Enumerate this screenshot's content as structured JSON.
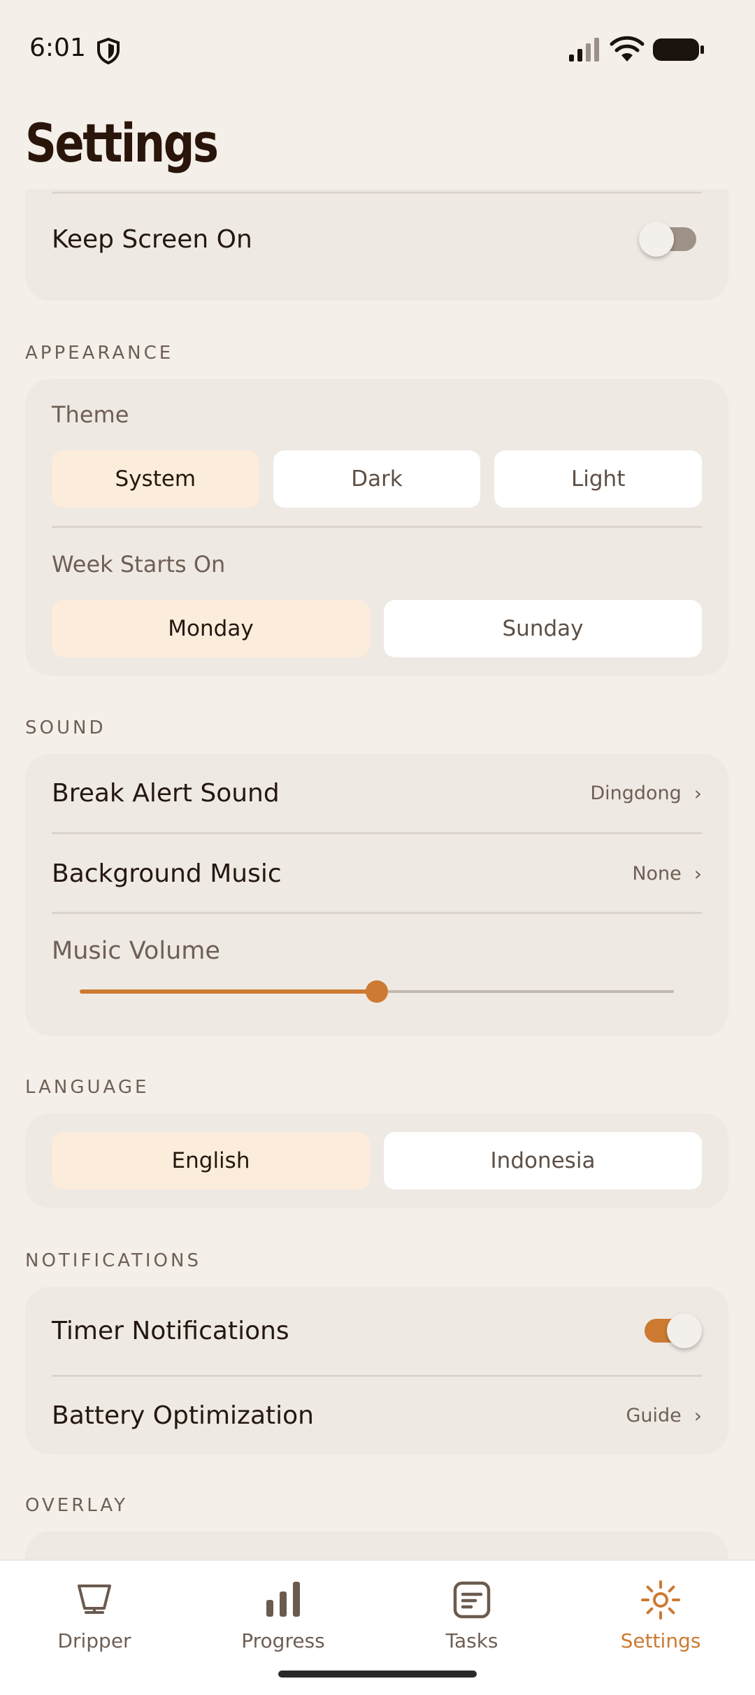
{
  "status_bar": {
    "time": "6:01"
  },
  "title": "Settings",
  "general": {
    "keep_screen_on_label": "Keep Screen On",
    "keep_screen_on": false
  },
  "appearance": {
    "section": "APPEARANCE",
    "theme_label": "Theme",
    "theme_options": [
      "System",
      "Dark",
      "Light"
    ],
    "theme_selected": "System",
    "week_label": "Week Starts On",
    "week_options": [
      "Monday",
      "Sunday"
    ],
    "week_selected": "Monday"
  },
  "sound": {
    "section": "SOUND",
    "break_alert_label": "Break Alert Sound",
    "break_alert_value": "Dingdong",
    "bg_music_label": "Background Music",
    "bg_music_value": "None",
    "volume_label": "Music Volume",
    "volume_fraction": 0.5
  },
  "language": {
    "section": "LANGUAGE",
    "options": [
      "English",
      "Indonesia"
    ],
    "selected": "English"
  },
  "notifications": {
    "section": "NOTIFICATIONS",
    "timer_label": "Timer Notifications",
    "timer_enabled": true,
    "battery_label": "Battery Optimization",
    "battery_value": "Guide"
  },
  "overlay": {
    "section": "OVERLAY"
  },
  "nav": {
    "items": [
      {
        "label": "Dripper",
        "icon": "dripper-icon"
      },
      {
        "label": "Progress",
        "icon": "bar-chart-icon"
      },
      {
        "label": "Tasks",
        "icon": "tasks-icon"
      },
      {
        "label": "Settings",
        "icon": "gear-icon"
      }
    ],
    "active": "Settings"
  },
  "colors": {
    "accent": "#cd7a32",
    "background": "#f4efe9",
    "card": "#efe9e3",
    "selected": "#fcecdc"
  }
}
